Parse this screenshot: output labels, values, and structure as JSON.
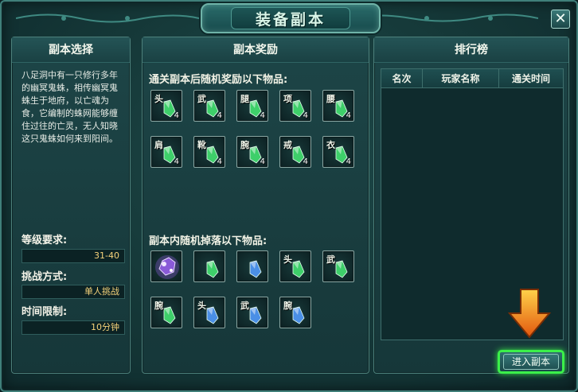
{
  "window": {
    "title": "装备副本",
    "close_symbol": "✕"
  },
  "select_panel": {
    "title": "副本选择",
    "description": "八足洞中有一只修行多年的幽冥鬼蛛，相传幽冥鬼蛛生于地府，以亡魂为食，它编制的蛛网能够缠住过往的亡灵，无人知晓这只鬼蛛如何来到阳间。",
    "level_label": "等级要求:",
    "level_value": "31-40",
    "mode_label": "挑战方式:",
    "mode_value": "单人挑战",
    "time_label": "时间限制:",
    "time_value": "10分钟"
  },
  "reward_panel": {
    "title": "副本奖励",
    "clear_label": "通关副本后随机奖励以下物品:",
    "clear_items": [
      {
        "glyph": "头",
        "count": "4",
        "icon": "green-crystal-icon"
      },
      {
        "glyph": "武",
        "count": "4",
        "icon": "green-crystal-icon"
      },
      {
        "glyph": "腿",
        "count": "4",
        "icon": "green-crystal-icon"
      },
      {
        "glyph": "项",
        "count": "4",
        "icon": "green-crystal-icon"
      },
      {
        "glyph": "腰",
        "count": "4",
        "icon": "green-crystal-icon"
      },
      {
        "glyph": "肩",
        "count": "4",
        "icon": "green-crystal-icon"
      },
      {
        "glyph": "靴",
        "count": "4",
        "icon": "green-crystal-icon"
      },
      {
        "glyph": "腕",
        "count": "4",
        "icon": "green-crystal-icon"
      },
      {
        "glyph": "戒",
        "count": "4",
        "icon": "green-crystal-icon"
      },
      {
        "glyph": "衣",
        "count": "4",
        "icon": "green-crystal-icon"
      }
    ],
    "drop_label": "副本内随机掉落以下物品:",
    "drop_items": [
      {
        "glyph": "",
        "icon": "purple-gem-icon"
      },
      {
        "glyph": "",
        "icon": "green-crystal-icon"
      },
      {
        "glyph": "",
        "icon": "blue-crystal-icon"
      },
      {
        "glyph": "头",
        "icon": "green-crystal-icon"
      },
      {
        "glyph": "武",
        "icon": "green-crystal-icon"
      },
      {
        "glyph": "腕",
        "icon": "green-crystal-icon"
      },
      {
        "glyph": "头",
        "icon": "blue-crystal-icon"
      },
      {
        "glyph": "武",
        "icon": "blue-crystal-icon"
      },
      {
        "glyph": "腕",
        "icon": "blue-crystal-icon"
      }
    ]
  },
  "rank_panel": {
    "title": "排行榜",
    "columns": [
      "名次",
      "玩家名称",
      "通关时间"
    ]
  },
  "enter_button": {
    "label": "进入副本"
  },
  "colors": {
    "green_crystal": "#3ecf6a",
    "blue_crystal": "#4a8fe6",
    "purple_gem": "#8a5ad8",
    "value_text": "#f5d27a",
    "enter_highlight": "#3bf04a",
    "arrow": "#f08a1a"
  }
}
